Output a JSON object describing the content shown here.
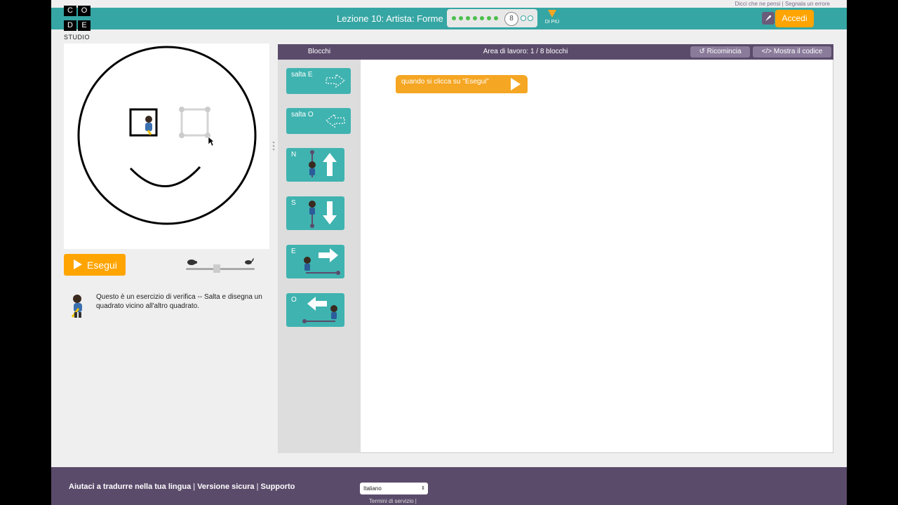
{
  "top_links": {
    "feedback": "Dicci che ne pensi",
    "report": "Segnala un errore"
  },
  "header": {
    "logo": {
      "letters": [
        "C",
        "O",
        "D",
        "E"
      ],
      "studio": "STUDIO"
    },
    "lesson_title": "Lezione 10: Artista: Forme",
    "current_level": "8",
    "more_label": "DI PIÙ",
    "login_label": "Accedi"
  },
  "colors": {
    "header": "#36a6a4",
    "accent_orange": "#ffa400",
    "block_teal": "#3fb3b0",
    "purple_bar": "#5b4b6b"
  },
  "run_button": {
    "label": "Esegui"
  },
  "speed": {
    "slow_icon": "turtle-icon",
    "fast_icon": "rabbit-icon",
    "level": 0.45
  },
  "instructions": {
    "text": "Questo è un esercizio di verifica -- Salta e disegna un quadrato vicino all'altro quadrato."
  },
  "toolbox": {
    "header": "Blocchi",
    "blocks": [
      {
        "label": "salta  E",
        "icon": "dashed-arrow-right-icon"
      },
      {
        "label": "salta  O",
        "icon": "dashed-arrow-left-icon"
      },
      {
        "label": "N",
        "icon": "arrow-up-icon"
      },
      {
        "label": "S",
        "icon": "arrow-down-icon"
      },
      {
        "label": "E",
        "icon": "arrow-right-icon"
      },
      {
        "label": "O",
        "icon": "arrow-left-icon"
      }
    ]
  },
  "workspace": {
    "title": "Area di lavoro: 1 / 8 blocchi",
    "reset_label": "Ricomincia",
    "show_code_label": "Mostra il codice",
    "when_run_block": "quando si clicca su \"Esegui\""
  },
  "footer": {
    "links": [
      "Aiutaci a tradurre nella tua lingua",
      "Versione sicura",
      "Supporto"
    ],
    "language": "Italiano",
    "terms": "Termini di servizio |"
  }
}
